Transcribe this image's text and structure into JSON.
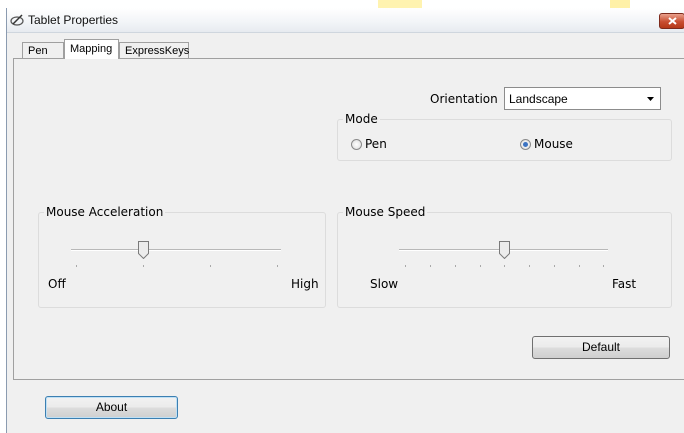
{
  "window": {
    "title": "Tablet Properties"
  },
  "tabs": [
    {
      "label": "Pen"
    },
    {
      "label": "Mapping",
      "active": true
    },
    {
      "label": "ExpressKeys"
    }
  ],
  "orientation": {
    "label": "Orientation",
    "selected": "Landscape"
  },
  "mode": {
    "title": "Mode",
    "options": [
      {
        "label": "Pen",
        "checked": false
      },
      {
        "label": "Mouse",
        "checked": true
      }
    ]
  },
  "mouse_acceleration": {
    "title": "Mouse Acceleration",
    "min_label": "Off",
    "max_label": "High",
    "value_fraction": 0.33
  },
  "mouse_speed": {
    "title": "Mouse Speed",
    "min_label": "Slow",
    "max_label": "Fast",
    "value_fraction": 0.5
  },
  "buttons": {
    "default": "Default",
    "about": "About"
  },
  "colors": {
    "close_button": "#c94e31",
    "radio_selected": "#3c73c2",
    "focus_border": "#3c7fb1",
    "banner_yellow": "#fff3b0"
  }
}
